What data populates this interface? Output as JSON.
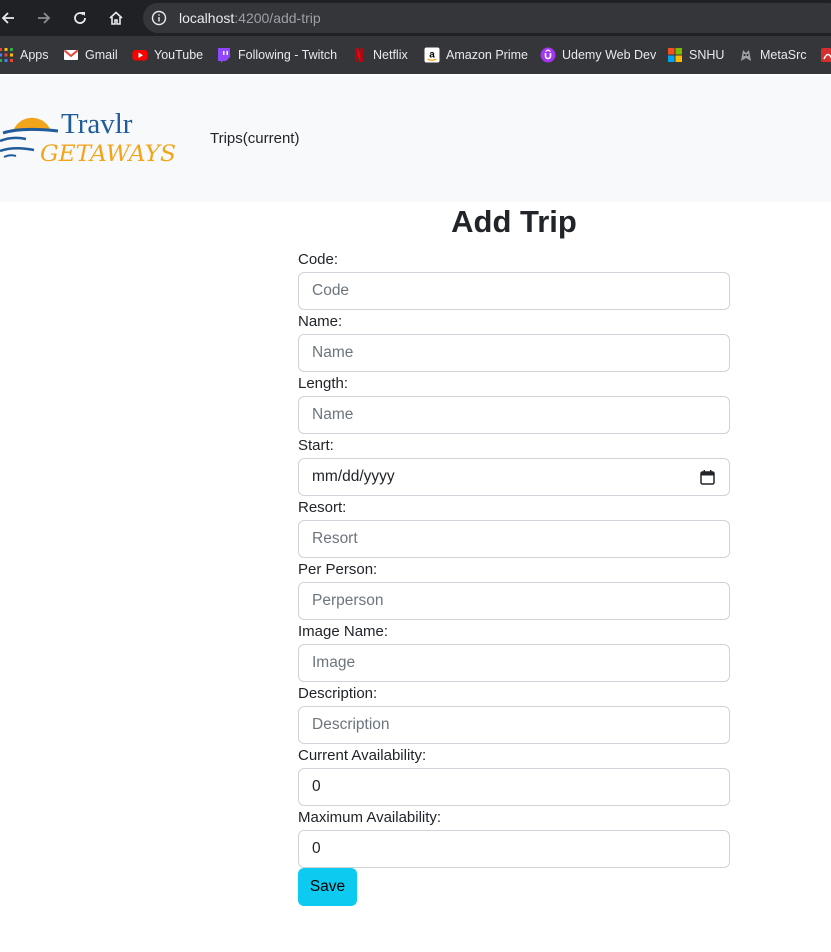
{
  "browser": {
    "url_host": "localhost",
    "url_path": ":4200/add-trip",
    "bookmarks": [
      {
        "label": "Apps",
        "icon": "apps-grid-icon"
      },
      {
        "label": "Gmail",
        "icon": "gmail-icon"
      },
      {
        "label": "YouTube",
        "icon": "youtube-icon"
      },
      {
        "label": "Following - Twitch",
        "icon": "twitch-icon"
      },
      {
        "label": "Netflix",
        "icon": "netflix-icon"
      },
      {
        "label": "Amazon Prime",
        "icon": "amazon-icon"
      },
      {
        "label": "Udemy Web Dev",
        "icon": "udemy-icon"
      },
      {
        "label": "SNHU",
        "icon": "microsoft-icon"
      },
      {
        "label": "MetaSrc",
        "icon": "metasrc-icon"
      }
    ]
  },
  "navbar": {
    "logo_top": "Travlr",
    "logo_bottom": "GETAWAYS",
    "link": "Trips(current)"
  },
  "form": {
    "title": "Add Trip",
    "fields": [
      {
        "label": "Code:",
        "placeholder": "Code",
        "value": ""
      },
      {
        "label": "Name:",
        "placeholder": "Name",
        "value": ""
      },
      {
        "label": "Length:",
        "placeholder": "Name",
        "value": ""
      },
      {
        "label": "Start:",
        "placeholder": "mm/dd/yyyy",
        "value": ""
      },
      {
        "label": "Resort:",
        "placeholder": "Resort",
        "value": ""
      },
      {
        "label": "Per Person:",
        "placeholder": "Perperson",
        "value": ""
      },
      {
        "label": "Image Name:",
        "placeholder": "Image",
        "value": ""
      },
      {
        "label": "Description:",
        "placeholder": "Description",
        "value": ""
      },
      {
        "label": "Current Availability:",
        "placeholder": "",
        "value": "0"
      },
      {
        "label": "Maximum Availability:",
        "placeholder": "",
        "value": "0"
      }
    ],
    "save_label": "Save"
  },
  "colors": {
    "accent_button": "#0dcaf0",
    "navbar_bg": "#f8f9fa",
    "logo_blue": "#1f5c99",
    "logo_orange": "#f2a51a"
  }
}
